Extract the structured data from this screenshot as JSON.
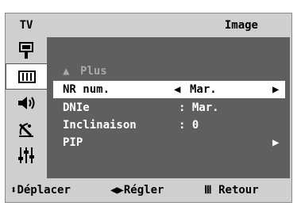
{
  "header": {
    "tv_label": "TV",
    "title": "Image"
  },
  "sidebar": {
    "icons": [
      "input-icon",
      "picture-icon",
      "sound-icon",
      "channel-icon",
      "setup-icon"
    ],
    "active_index": 1
  },
  "menu": {
    "more": {
      "arrow": "▲",
      "label": "Plus"
    },
    "items": [
      {
        "label": "NR num.",
        "value": "Mar.",
        "selected": true,
        "left_arrow": "◀",
        "right_arrow": "▶"
      },
      {
        "label": "DNIe",
        "value": ": Mar."
      },
      {
        "label": "Inclinaison",
        "value": ": 0"
      },
      {
        "label": "PIP",
        "value": "",
        "right_arrow": "▶"
      }
    ]
  },
  "footer": {
    "move_icon": "⬍",
    "move_label": "Déplacer",
    "adjust_icon": "◀▶",
    "adjust_label": "Régler",
    "return_icon": "Ⅲ",
    "return_label": "Retour"
  },
  "colors": {
    "frame": "#cfcfcf",
    "panel": "#5f5f5f",
    "highlight": "#ffffff",
    "dim_text": "#a8a8a8"
  }
}
